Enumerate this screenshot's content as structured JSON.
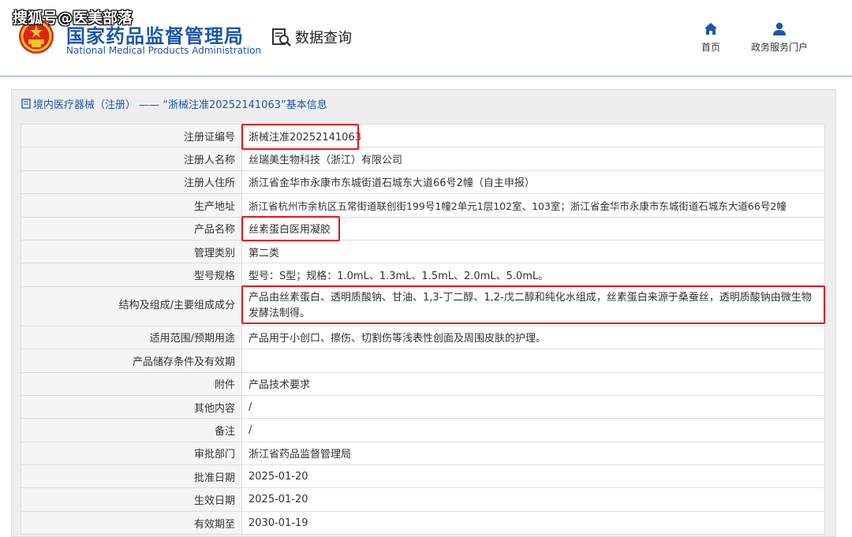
{
  "watermark": "搜狐号@医美部落",
  "header": {
    "logo_cn": "国家药品监督管理局",
    "logo_en": "National Medical Products Administration",
    "data_query": "数据查询",
    "nav": {
      "home": "首页",
      "portal": "政务服务门户"
    }
  },
  "panel": {
    "title": "境内医疗器械（注册） —— “浙械注准20252141063”基本信息"
  },
  "rows": [
    {
      "label": "注册证编号",
      "value": "浙械注准20252141063"
    },
    {
      "label": "注册人名称",
      "value": "丝瑞美生物科技（浙江）有限公司"
    },
    {
      "label": "注册人住所",
      "value": "浙江省金华市永康市东城街道石城东大道66号2幢（自主申报）"
    },
    {
      "label": "生产地址",
      "value": "浙江省杭州市余杭区五常街道联创街199号1幢2单元1层102室、103室；浙江省金华市永康市东城街道石城东大道66号2幢"
    },
    {
      "label": "产品名称",
      "value": "丝素蛋白医用凝胶"
    },
    {
      "label": "管理类别",
      "value": "第二类"
    },
    {
      "label": "型号规格",
      "value": "型号：S型；规格：1.0mL、1.3mL、1.5mL、2.0mL、5.0mL。"
    },
    {
      "label": "结构及组成/主要组成成分",
      "value": "产品由丝素蛋白、透明质酸钠、甘油、1,3-丁二醇、1,2-戊二醇和纯化水组成，丝素蛋白来源于桑蚕丝，透明质酸钠由微生物发酵法制得。"
    },
    {
      "label": "适用范围/预期用途",
      "value": "产品用于小创口、擦伤、切割伤等浅表性创面及周围皮肤的护理。"
    },
    {
      "label": "产品储存条件及有效期",
      "value": ""
    },
    {
      "label": "附件",
      "value": "产品技术要求"
    },
    {
      "label": "其他内容",
      "value": "/"
    },
    {
      "label": "备注",
      "value": "/"
    },
    {
      "label": "审批部门",
      "value": "浙江省药品监督管理局"
    },
    {
      "label": "批准日期",
      "value": "2025-01-20"
    },
    {
      "label": "生效日期",
      "value": "2025-01-20"
    },
    {
      "label": "有效期至",
      "value": "2030-01-19"
    }
  ],
  "colors": {
    "brand_blue": "#1d57a8",
    "highlight_red": "#e8131a",
    "label_bg": "#f5f5f5"
  }
}
